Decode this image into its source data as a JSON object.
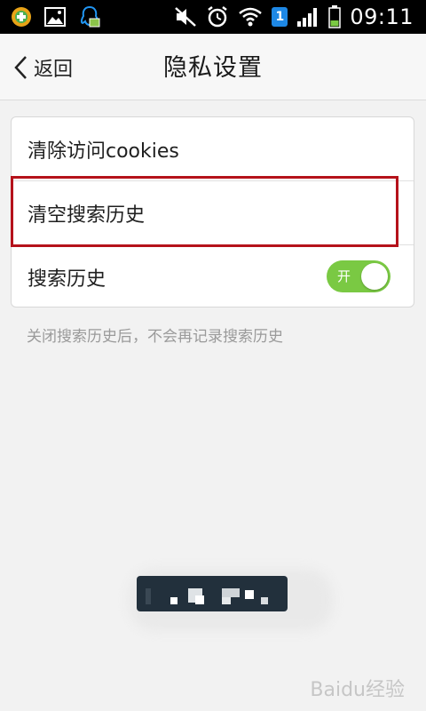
{
  "status_bar": {
    "time": "09:11",
    "sim_number": "1",
    "icons_left": [
      "app-icon",
      "image-icon",
      "qq-icon"
    ],
    "icons_right": [
      "mute-icon",
      "alarm-icon",
      "wifi-icon",
      "sim-icon",
      "signal-icon",
      "battery-icon"
    ]
  },
  "header": {
    "back_label": "返回",
    "title": "隐私设置"
  },
  "settings": {
    "items": [
      {
        "label": "清除访问cookies"
      },
      {
        "label": "清空搜索历史"
      },
      {
        "label": "搜索历史",
        "toggle_label": "开",
        "toggle_on": true
      }
    ],
    "hint": "关闭搜索历史后，不会再记录搜索历史"
  },
  "colors": {
    "toggle_on": "#7ac943",
    "highlight": "#b5121b"
  },
  "watermark": "Baidu经验"
}
